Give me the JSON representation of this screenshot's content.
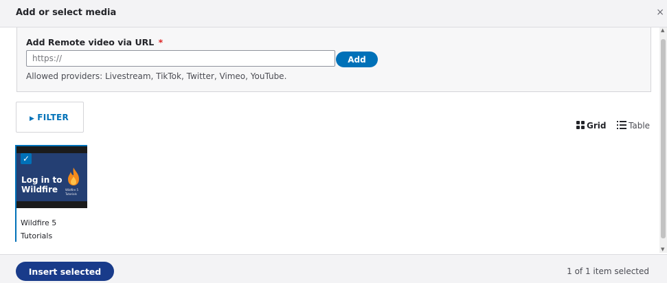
{
  "dialog": {
    "title": "Add or select media",
    "close_glyph": "×"
  },
  "remote_video": {
    "label": "Add Remote video via URL",
    "required_marker": "*",
    "input_placeholder": "https://",
    "input_value": "",
    "add_label": "Add",
    "help": "Allowed providers: Livestream, TikTok, Twitter, Vimeo, YouTube."
  },
  "filter": {
    "label": "FILTER",
    "icon": "triangle-right-icon"
  },
  "view": {
    "grid_label": "Grid",
    "grid_icon": "grid-icon",
    "table_label": "Table",
    "table_icon": "list-icon",
    "active": "grid"
  },
  "media_items": [
    {
      "name": "Wildfire 5 Tutorials",
      "thumbnail_title": "Log in to Wildfire",
      "thumbnail_subtitle": "Wildfire 5 Tutorials",
      "selected": true
    }
  ],
  "footer": {
    "insert_label": "Insert selected",
    "status": "1 of 1 item selected"
  },
  "colors": {
    "accent": "#0071b8",
    "primary_button": "#193b8a",
    "required": "#dc2323",
    "thumbnail_bg": "#243f73"
  }
}
